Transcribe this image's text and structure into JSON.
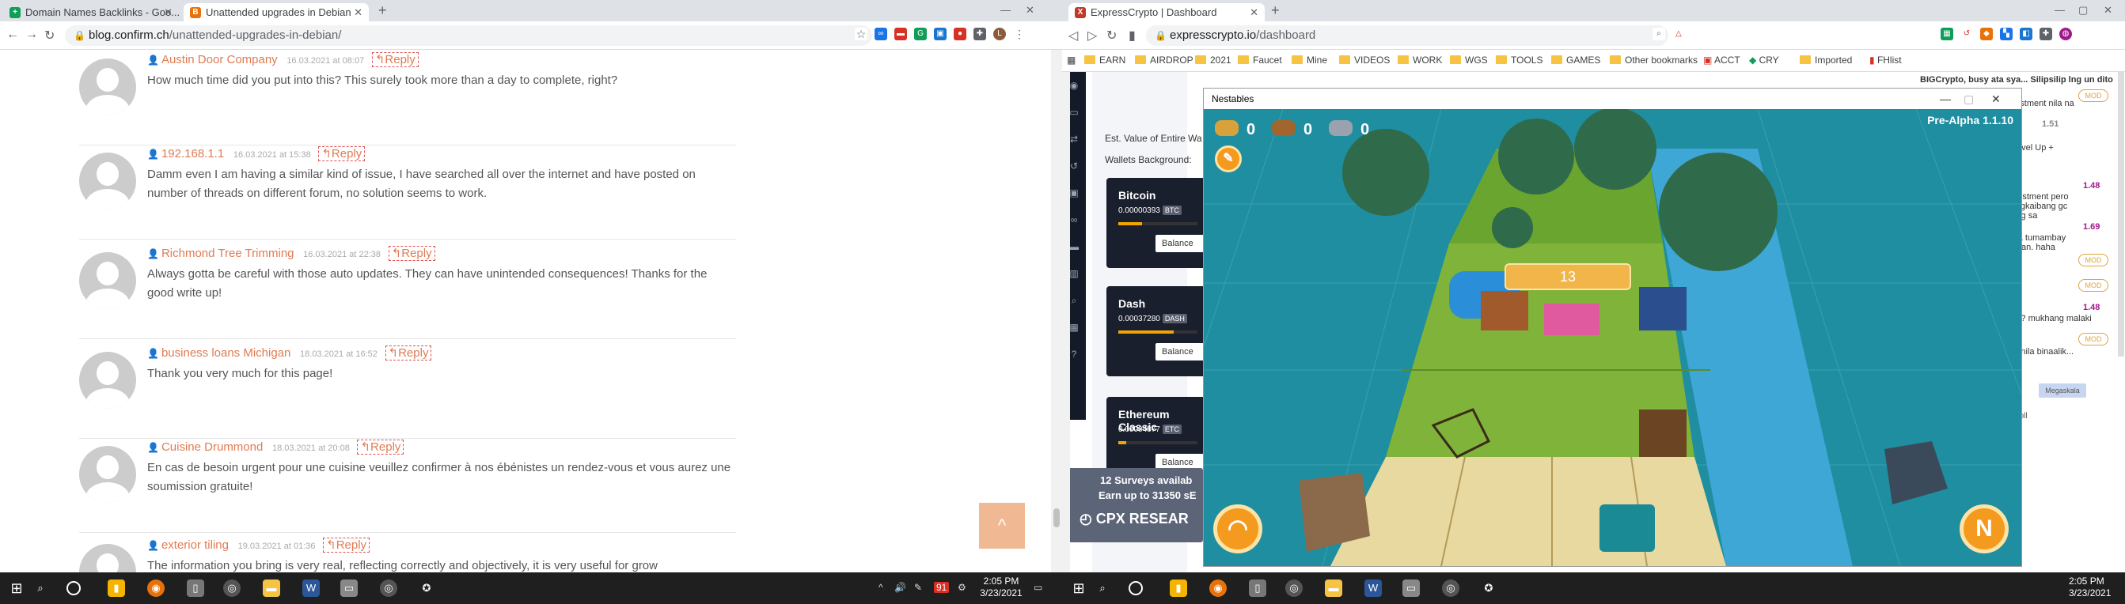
{
  "left": {
    "tabs": [
      {
        "title": "Domain Names Backlinks - Goo...",
        "icon_color": "#0f9d58",
        "icon_letter": "+",
        "active": false
      },
      {
        "title": "Unattended upgrades in Debian",
        "icon_color": "#e8710a",
        "icon_letter": "B",
        "active": true
      }
    ],
    "new_tab": "+",
    "url_host": "blog.confirm.ch",
    "url_path": "/unattended-upgrades-in-debian/",
    "comments": [
      {
        "author": "Austin Door Company",
        "date": "16.03.2021 at 08:07",
        "reply": "Reply",
        "text": "How much time did you put into this? This surely took more than a day to complete, right?"
      },
      {
        "author": "192.168.1.1",
        "date": "16.03.2021 at 15:38",
        "reply": "Reply",
        "text": "Damm even I am having a similar kind of issue, I have searched all over the internet and have posted on number of threads on different forum, no solution seems to work."
      },
      {
        "author": "Richmond Tree Trimming",
        "date": "16.03.2021 at 22:38",
        "reply": "Reply",
        "text": "Always gotta be careful with those auto updates. They can have unintended consequences! Thanks for the good write up!"
      },
      {
        "author": "business loans Michigan",
        "date": "18.03.2021 at 16:52",
        "reply": "Reply",
        "text": "Thank you very much for this page!"
      },
      {
        "author": "Cuisine Drummond",
        "date": "18.03.2021 at 20:08",
        "reply": "Reply",
        "text": "En cas de besoin urgent pour une cuisine veuillez confirmer à nos ébénistes un rendez-vous et vous aurez une soumission gratuite!"
      },
      {
        "author": "exterior tiling",
        "date": "19.03.2021 at 01:36",
        "reply": "Reply",
        "text": "The information you bring is very real, reflecting correctly and objectively, it is very useful for grow"
      }
    ],
    "scroll_top": "^",
    "clock_time": "2:05 PM",
    "clock_date": "3/23/2021",
    "tray_badge": "91"
  },
  "right": {
    "tabs": [
      {
        "title": "ExpressCrypto | Dashboard",
        "icon_color": "#c0392b",
        "icon_letter": "X",
        "active": true
      }
    ],
    "new_tab": "+",
    "url_host": "expresscrypto.io",
    "url_path": "/dashboard",
    "bookmarks": [
      {
        "label": "EARN",
        "folder": true
      },
      {
        "label": "AIRDROP",
        "folder": true
      },
      {
        "label": "2021",
        "folder": true
      },
      {
        "label": "Faucet",
        "folder": true
      },
      {
        "label": "Mine",
        "folder": true
      },
      {
        "label": "VIDEOS",
        "folder": true
      },
      {
        "label": "WORK",
        "folder": true
      },
      {
        "label": "WGS",
        "folder": true
      },
      {
        "label": "TOOLS",
        "folder": true
      },
      {
        "label": "GAMES",
        "folder": true
      },
      {
        "label": "Other bookmarks",
        "folder": true
      },
      {
        "label": "ACCT",
        "folder": false
      },
      {
        "label": "CRY",
        "folder": false
      },
      {
        "label": "Imported",
        "folder": true
      },
      {
        "label": "FHlist",
        "folder": false
      }
    ],
    "dashboard": {
      "est_value_label": "Est. Value of Entire Wa",
      "wallets_bg_label": "Wallets Background:",
      "wallets": [
        {
          "name": "Bitcoin",
          "amount": "0.00000393",
          "ticker": "BTC",
          "balance_btn": "Balance",
          "fill": 0.3
        },
        {
          "name": "Dash",
          "amount": "0.00037280",
          "ticker": "DASH",
          "balance_btn": "Balance",
          "fill": 0.7
        },
        {
          "name": "Ethereum Classic",
          "amount": "0.00004877",
          "ticker": "ETC",
          "balance_btn": "Balance",
          "fill": 0.1
        }
      ],
      "survey_line1": "12 Surveys availab",
      "survey_line2": "Earn up to 31350 sE",
      "survey_brand": "CPX RESEAR"
    },
    "chat": {
      "lines": [
        {
          "text": "BIGCrypto, busy ata sya... Silipsilip lng un dito",
          "num": "",
          "mod": false
        },
        {
          "text": "ainvestment nila na",
          "num": "",
          "mod": true
        },
        {
          "text": "",
          "num": "1.51",
          "mod": false
        },
        {
          "text": "*** Level Up +",
          "num": "",
          "mod": false
        },
        {
          "text": "",
          "num": "1.48",
          "mod": false
        },
        {
          "text": "n investment pero nasa gkaibang gc ba ung sa",
          "num": "",
          "mod": false
        },
        {
          "text": "",
          "num": "1.69",
          "mod": false
        },
        {
          "text": "sana tumambay sila lan. haha",
          "num": "",
          "mod": true
        },
        {
          "text": "",
          "num": "",
          "mod": true
        },
        {
          "text": "",
          "num": "1.48",
          "mod": false
        },
        {
          "text": "mod? mukhang malaki",
          "num": "",
          "mod": false
        },
        {
          "text": "end nila binaalik...",
          "num": "",
          "mod": true
        }
      ],
      "mod_label": "MOD",
      "send_btn": "Megaskala",
      "scroll_label": "t scroll"
    },
    "nestables": {
      "window_title": "Nestables",
      "version": "Pre-Alpha 1.1.10",
      "resource_1": "0",
      "resource_2": "0",
      "resource_3": "0",
      "counter": "13",
      "btn_left_icon": "nest-icon",
      "btn_right_letter": "N"
    },
    "clock_time": "2:05 PM",
    "clock_date": "3/23/2021"
  },
  "colors": {
    "accent_orange": "#e07b53",
    "game_water": "#1f8ea0",
    "game_grass": "#7fb33a",
    "game_sand": "#e8d9a0",
    "ec_dark": "#1a1f2e"
  }
}
